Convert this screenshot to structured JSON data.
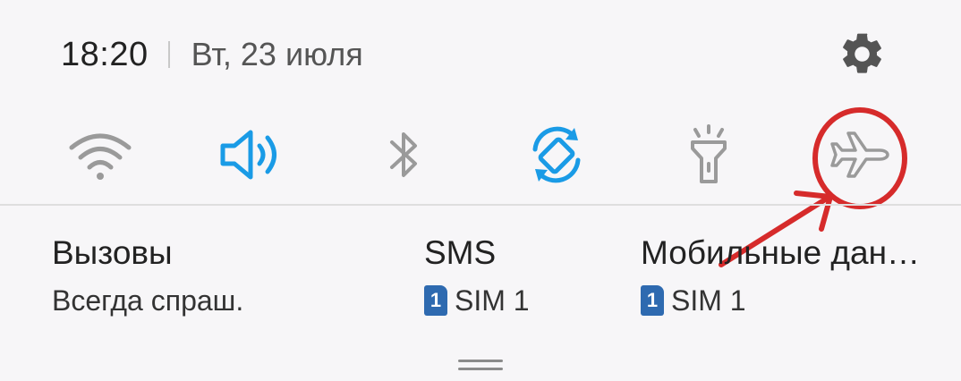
{
  "status": {
    "time": "18:20",
    "date": "Вт, 23 июля"
  },
  "icons": {
    "settings": "gear-icon",
    "wifi": "wifi-icon",
    "sound": "volume-icon",
    "bluetooth": "bluetooth-icon",
    "auto_rotate": "auto-rotate-icon",
    "flashlight": "flashlight-icon",
    "airplane": "airplane-icon"
  },
  "toggles": [
    {
      "id": "wifi",
      "active": false
    },
    {
      "id": "sound",
      "active": true
    },
    {
      "id": "bluetooth",
      "active": false
    },
    {
      "id": "auto_rotate",
      "active": true
    },
    {
      "id": "flashlight",
      "active": false
    },
    {
      "id": "airplane",
      "active": false
    }
  ],
  "sim": {
    "calls": {
      "title": "Вызовы",
      "subtitle": "Всегда спраш."
    },
    "sms": {
      "title": "SMS",
      "badge": "1",
      "subtitle": "SIM 1"
    },
    "mobile_data": {
      "title": "Мобильные дан…",
      "badge": "1",
      "subtitle": "SIM 1"
    }
  },
  "colors": {
    "active": "#1a9be6",
    "inactive": "#9a9a9a",
    "annotation": "#d62b2b",
    "sim_badge": "#2e6ab0"
  }
}
